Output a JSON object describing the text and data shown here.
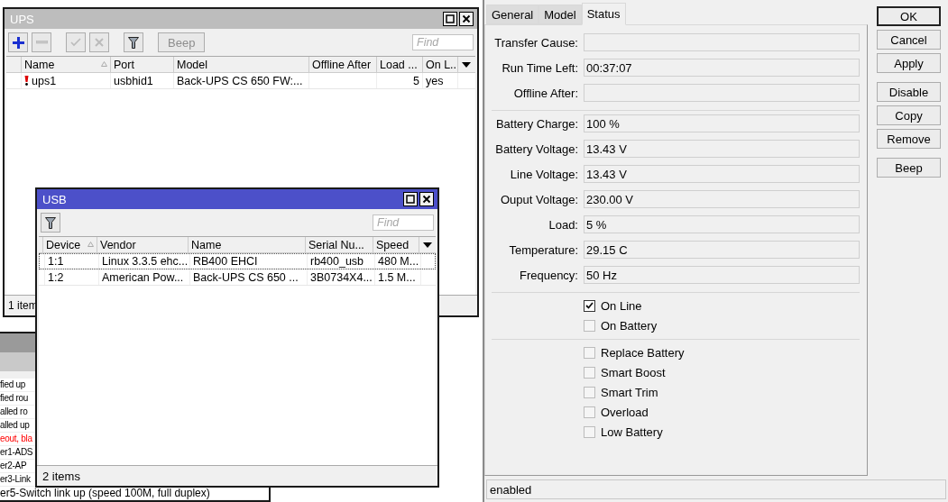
{
  "desktop": {
    "ups_window": {
      "title": "UPS",
      "active": false,
      "toolbar": [
        {
          "kind": "add",
          "disabled": false
        },
        {
          "kind": "remove",
          "disabled": true
        },
        {
          "kind": "enable",
          "disabled": true
        },
        {
          "kind": "disable",
          "disabled": true
        },
        {
          "kind": "filter",
          "disabled": false
        },
        {
          "kind": "text",
          "label": "Beep",
          "disabled": true
        }
      ],
      "find": {
        "placeholder": "Find"
      },
      "columns": [
        {
          "label": "Name",
          "sorted": true
        },
        {
          "label": "Port",
          "sorted": false
        },
        {
          "label": "Model",
          "sorted": false
        },
        {
          "label": "Offline After",
          "sorted": false
        },
        {
          "label": "Load ...",
          "sorted": false
        },
        {
          "label": "On L...",
          "sorted": false
        }
      ],
      "rows": [
        {
          "alert": true,
          "focused": false,
          "cells": [
            "ups1",
            "usbhid1",
            "Back-UPS CS 650 FW:...",
            "",
            "5",
            "yes"
          ]
        }
      ],
      "status": "1 item"
    },
    "usb_window": {
      "title": "USB",
      "active": true,
      "toolbar": [
        {
          "kind": "filter",
          "disabled": false
        }
      ],
      "find": {
        "placeholder": "Find"
      },
      "columns": [
        {
          "label": "Device",
          "sorted": true
        },
        {
          "label": "Vendor",
          "sorted": false
        },
        {
          "label": "Name",
          "sorted": false
        },
        {
          "label": "Serial Nu...",
          "sorted": false
        },
        {
          "label": "Speed",
          "sorted": false
        }
      ],
      "rows": [
        {
          "alert": false,
          "focused": true,
          "cells": [
            "1:1",
            "Linux 3.3.5 ehc...",
            "RB400 EHCI",
            "rb400_usb",
            "480 M..."
          ]
        },
        {
          "alert": false,
          "focused": false,
          "cells": [
            "1:2",
            "American Pow...",
            "Back-UPS CS 650 ...",
            "3B0734X4...",
            "1.5 M..."
          ]
        }
      ],
      "status": "2 items"
    },
    "log_window": {
      "lines": [
        {
          "text": "fied up",
          "kind": "info"
        },
        {
          "text": "fied rou",
          "kind": "info"
        },
        {
          "text": "alled ro",
          "kind": "info"
        },
        {
          "text": "alled up",
          "kind": "info"
        },
        {
          "text": "eout, bla",
          "kind": "error"
        },
        {
          "text": "er1-ADS",
          "kind": "info"
        },
        {
          "text": "er2-AP",
          "kind": "info"
        },
        {
          "text": "er3-Link",
          "kind": "info"
        },
        {
          "text": "er5-Switch link up (speed 100M, full duplex)",
          "kind": "info"
        }
      ]
    }
  },
  "dialog": {
    "tabs": [
      {
        "label": "General",
        "selected": false
      },
      {
        "label": "Model",
        "selected": false
      },
      {
        "label": "Status",
        "selected": true
      }
    ],
    "sections": [
      {
        "kind": "fields",
        "fields": [
          {
            "label": "Transfer Cause:"
          },
          {
            "label": "Run Time Left:",
            "value": "00:37:07"
          },
          {
            "label": "Offline After:"
          }
        ]
      },
      {
        "kind": "fields",
        "fields": [
          {
            "label": "Battery Charge:",
            "value": "100 %"
          },
          {
            "label": "Battery Voltage:",
            "value": "13.43 V"
          },
          {
            "label": "Line Voltage:",
            "value": "13.43 V"
          },
          {
            "label": "Ouput Voltage:",
            "value": "230.00 V"
          },
          {
            "label": "Load:",
            "value": "5 %"
          },
          {
            "label": "Temperature:",
            "value": "29.15 C"
          },
          {
            "label": "Frequency:",
            "value": "50 Hz"
          }
        ]
      },
      {
        "kind": "checks",
        "items": [
          {
            "label": "On Line",
            "checked": true
          },
          {
            "label": "On Battery",
            "checked": false
          }
        ]
      },
      {
        "kind": "checks",
        "items": [
          {
            "label": "Replace Battery",
            "checked": false
          },
          {
            "label": "Smart Boost",
            "checked": false
          },
          {
            "label": "Smart Trim",
            "checked": false
          },
          {
            "label": "Overload",
            "checked": false
          },
          {
            "label": "Low Battery",
            "checked": false
          }
        ]
      }
    ],
    "button_groups": [
      [
        {
          "label": "OK",
          "default": true
        },
        {
          "label": "Cancel",
          "default": false
        },
        {
          "label": "Apply",
          "default": false
        }
      ],
      [
        {
          "label": "Disable",
          "default": false
        },
        {
          "label": "Copy",
          "default": false
        },
        {
          "label": "Remove",
          "default": false
        }
      ],
      [
        {
          "label": "Beep",
          "default": false
        }
      ]
    ],
    "status": "enabled"
  }
}
